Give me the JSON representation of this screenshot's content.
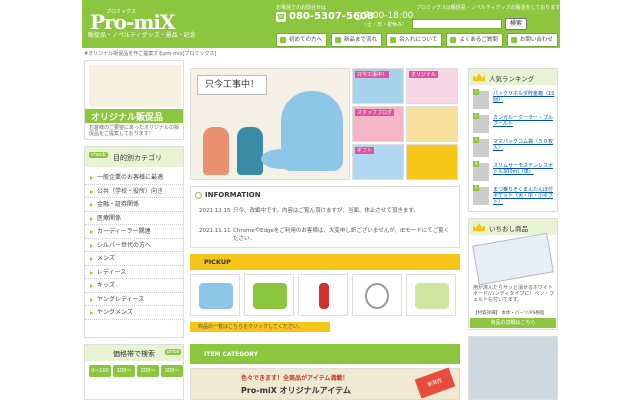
{
  "header": {
    "logo_small": "プロミックス",
    "logo": "Pro-miX",
    "logo_sub": "販促品・ノベルティグッズ・景品・記念",
    "phone_label": "お電話でのお問合せは",
    "phone_number": "080-5307-5608",
    "hours": "7:00-18:00",
    "hours_note": "（土・日・祝休み）",
    "tagline": "プロミックスは販促品・ノベルティグッズの製造をしております",
    "search_placeholder": "",
    "search_button": "検索"
  },
  "nav": [
    {
      "label": "初めての方へ"
    },
    {
      "label": "新品まで流れ"
    },
    {
      "label": "名入れについて"
    },
    {
      "label": "よくあるご質問"
    },
    {
      "label": "お問い合わせ"
    }
  ],
  "breadcrumb": "#オリジナル販促品を作ご提案するpro-mix[プロミックス]",
  "promo": {
    "title": "オリジナル販促品",
    "text": "お客様のご要望にあったオリジナルの販促品をご提案しております！"
  },
  "purpose": {
    "tag": "check",
    "title": "目的別カテゴリ",
    "items": [
      "一般企業のお客様に最適",
      "公共（学校・役所）向き",
      "金融・証券関係",
      "医療関係",
      "カーディーラー関連",
      "シルバー世代の方へ",
      "メンズ",
      "レディース",
      "キッズ",
      "ヤングレディース",
      "ヤングメンズ"
    ]
  },
  "price": {
    "title": "価格帯で検索",
    "tag": "price",
    "chips": [
      "0〜100円",
      "100〜200円",
      "200〜300円",
      "300〜500円"
    ]
  },
  "hero": {
    "sign": "只今工事中！"
  },
  "thumbs": [
    {
      "label": "只今工事中！",
      "color": "#a7d3ea"
    },
    {
      "label": "オリジナル",
      "color": "#e0529c"
    },
    {
      "label": "スタッフブログ",
      "color": "#f5b6c8"
    },
    {
      "label": "",
      "color": "#f7e09b"
    },
    {
      "label": "ギフト",
      "color": "#b0d8f0"
    },
    {
      "label": "",
      "color": "#f5c518"
    }
  ],
  "info": {
    "title": "INFORMATION",
    "rows": [
      {
        "date": "2021.12.15",
        "text": "只今、改編中です。内容はご覧ん頂けますが、当面、休止させて頂きます。"
      },
      {
        "date": "2021.11.11",
        "text": "ChromeやEdgeをご利用のお客様は、大変申し訳ございませんが、IEモードにてご覧ください。"
      }
    ]
  },
  "pickup": {
    "title": "PICKUP",
    "note": "商品の一覧はこちらをクリックしてください。",
    "items": [
      {
        "color": "#8ec6e8"
      },
      {
        "color": "#8cc63f"
      },
      {
        "color": "#d0342c"
      },
      {
        "color": "#e8e8e8"
      },
      {
        "color": "#cfe6a3"
      }
    ]
  },
  "category": {
    "title": "ITEM CATEGORY",
    "banner_text": "色々できます！全商品がアイテム満載！",
    "banner_logo": "Pro-miX オリジナルアイテム",
    "badge": "新発売"
  },
  "ranking": {
    "title": "人気ランキング",
    "items": [
      {
        "num": "1",
        "text": "パックリホルダ貯金箱（15個）"
      },
      {
        "num": "2",
        "text": "カンガルークーラー・プルフールト"
      },
      {
        "num": "3",
        "text": "ママパッグコム袋（５０枚入）"
      },
      {
        "num": "4",
        "text": "スリムサーモステンレスボトル300ml（単）"
      },
      {
        "num": "5",
        "text": "まつ乗りぞくまんたんぼ付ポケット（大・中・小ギフト）"
      }
    ]
  },
  "osusume": {
    "title": "いちおし商品",
    "text": "用が済んだらサッと消せるホワイトボード/ハンディタイプに！ペン・フェルトも付いてます。",
    "spec": "【材質詳細】 本体・パーツ/PS樹脂",
    "link": "商品の詳細はこちら"
  }
}
